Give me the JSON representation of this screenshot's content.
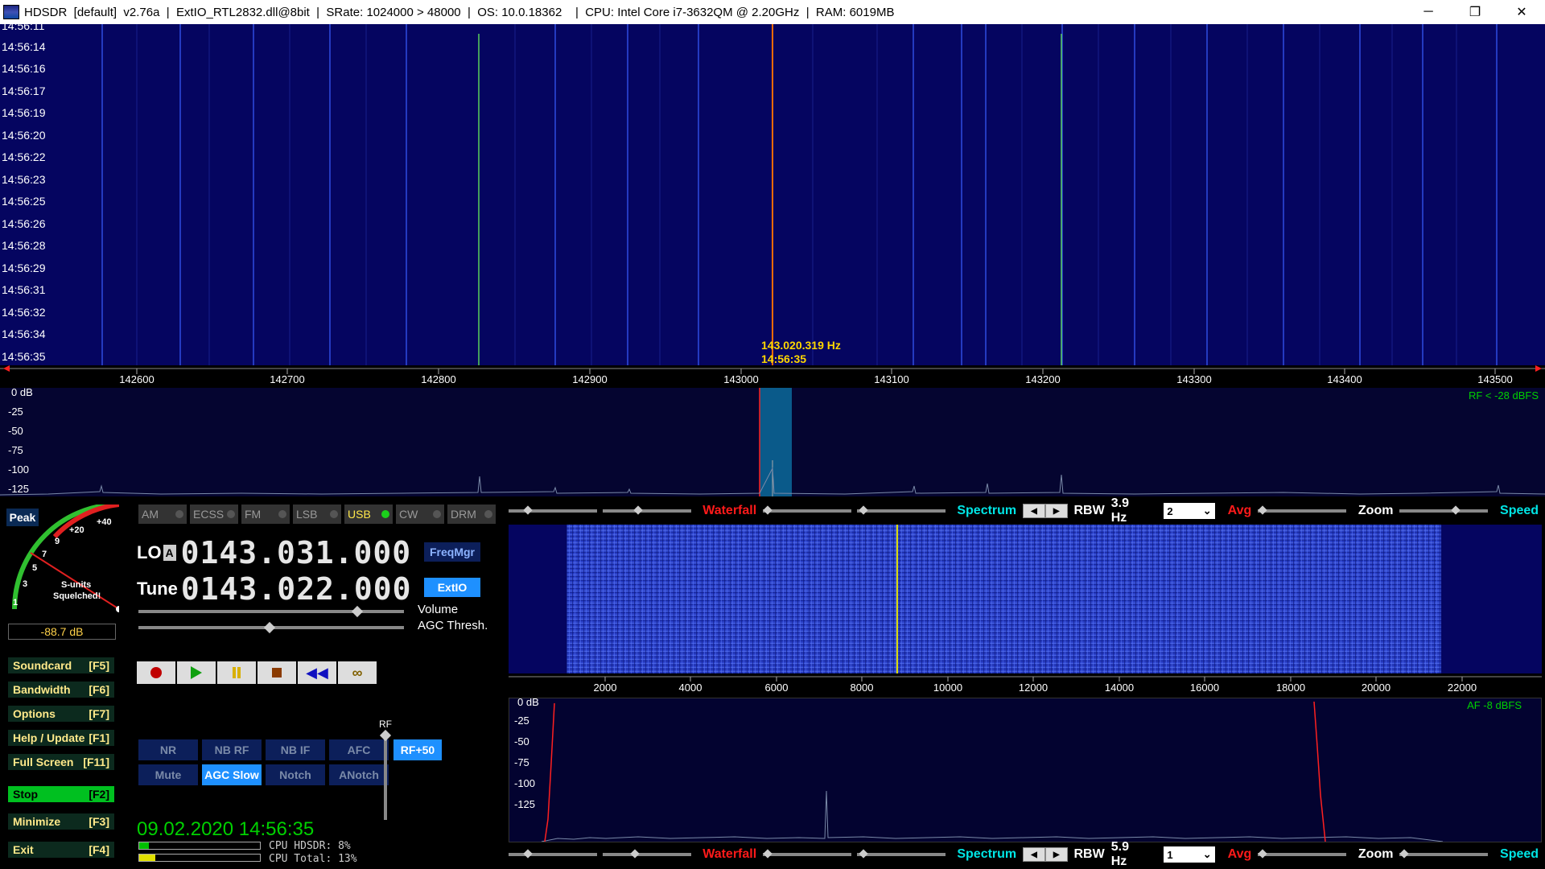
{
  "window": {
    "title": "HDSDR  [default]  v2.76a  |  ExtIO_RTL2832.dll@8bit  |  SRate: 1024000 > 48000  |  OS: 10.0.18362    |  CPU: Intel Core i7-3632QM @ 2.20GHz  |  RAM: 6019MB",
    "minimize_icon": "─",
    "restore_icon": "❐",
    "close_icon": "✕"
  },
  "waterfall": {
    "times": [
      "14:56:11",
      "14:56:14",
      "14:56:16",
      "14:56:17",
      "14:56:19",
      "14:56:20",
      "14:56:22",
      "14:56:23",
      "14:56:25",
      "14:56:26",
      "14:56:28",
      "14:56:29",
      "14:56:31",
      "14:56:32",
      "14:56:34",
      "14:56:35"
    ],
    "cursor_freq": "143.020.319 Hz",
    "cursor_time": "14:56:35"
  },
  "freq_scale": {
    "labels": [
      "142600",
      "142700",
      "142800",
      "142900",
      "143000",
      "143100",
      "143200",
      "143300",
      "143400",
      "143500"
    ]
  },
  "rf_spectrum": {
    "db_labels": [
      "0 dB",
      "-25",
      "-50",
      "-75",
      "-100",
      "-125"
    ],
    "level": "RF < -28 dBFS"
  },
  "smeter": {
    "peak_label": "Peak",
    "scale": [
      "1",
      "3",
      "5",
      "7",
      "9",
      "+20",
      "+40"
    ],
    "caption1": "S-units",
    "caption2": "Squelched!",
    "readout": "-88.7 dB"
  },
  "side_buttons": [
    {
      "label": "Soundcard",
      "key": "[F5]"
    },
    {
      "label": "Bandwidth",
      "key": "[F6]"
    },
    {
      "label": "Options",
      "key": "[F7]"
    },
    {
      "label": "Help / Update",
      "key": "[F1]"
    },
    {
      "label": "Full Screen",
      "key": "[F11]"
    },
    {
      "label": "Stop",
      "key": "[F2]"
    },
    {
      "label": "Minimize",
      "key": "[F3]"
    },
    {
      "label": "Exit",
      "key": "[F4]"
    }
  ],
  "modes": [
    "AM",
    "ECSS",
    "FM",
    "LSB",
    "USB",
    "CW",
    "DRM"
  ],
  "active_mode": "USB",
  "lo": {
    "label": "LO",
    "bank": "A",
    "value": "0143.031.000"
  },
  "tune": {
    "label": "Tune",
    "value": "0143.022.000"
  },
  "freqmgr_label": "FreqMgr",
  "extio_label": "ExtIO",
  "volume_label": "Volume",
  "agc_label": "AGC Thresh.",
  "dsp_buttons": [
    "NR",
    "NB RF",
    "NB IF",
    "AFC",
    "Mute",
    "AGC Slow",
    "Notch",
    "ANotch"
  ],
  "active_dsp": "AGC Slow",
  "rf_label": "RF",
  "rf_gain": "RF+50",
  "datetime": "09.02.2020 14:56:35",
  "cpu": {
    "hdsdr_label": "CPU HDSDR:  8%",
    "total_label": "CPU Total: 13%",
    "hdsdr_pct": 8,
    "total_pct": 13
  },
  "rf_controls": {
    "waterfall_label": "Waterfall",
    "spectrum_label": "Spectrum",
    "rbw_label": "RBW",
    "rbw_value": "3.9 Hz",
    "avg_value": "2",
    "avg_label": "Avg",
    "zoom_label": "Zoom",
    "speed_label": "Speed"
  },
  "af_controls": {
    "waterfall_label": "Waterfall",
    "spectrum_label": "Spectrum",
    "rbw_label": "RBW",
    "rbw_value": "5.9 Hz",
    "avg_value": "1",
    "avg_label": "Avg",
    "zoom_label": "Zoom",
    "speed_label": "Speed"
  },
  "af_scale": {
    "labels": [
      "2000",
      "4000",
      "6000",
      "8000",
      "10000",
      "12000",
      "14000",
      "16000",
      "18000",
      "20000",
      "22000"
    ]
  },
  "af_spectrum": {
    "db_labels": [
      "0 dB",
      "-25",
      "-50",
      "-75",
      "-100",
      "-125"
    ],
    "level": "AF -8 dBFS"
  },
  "colors": {
    "waterfall_bg": "#050560",
    "accent_blue": "#1e90ff",
    "green": "#00d000",
    "cursor_orange": "#ff6a00",
    "cursor_yellow": "#ffd700"
  }
}
